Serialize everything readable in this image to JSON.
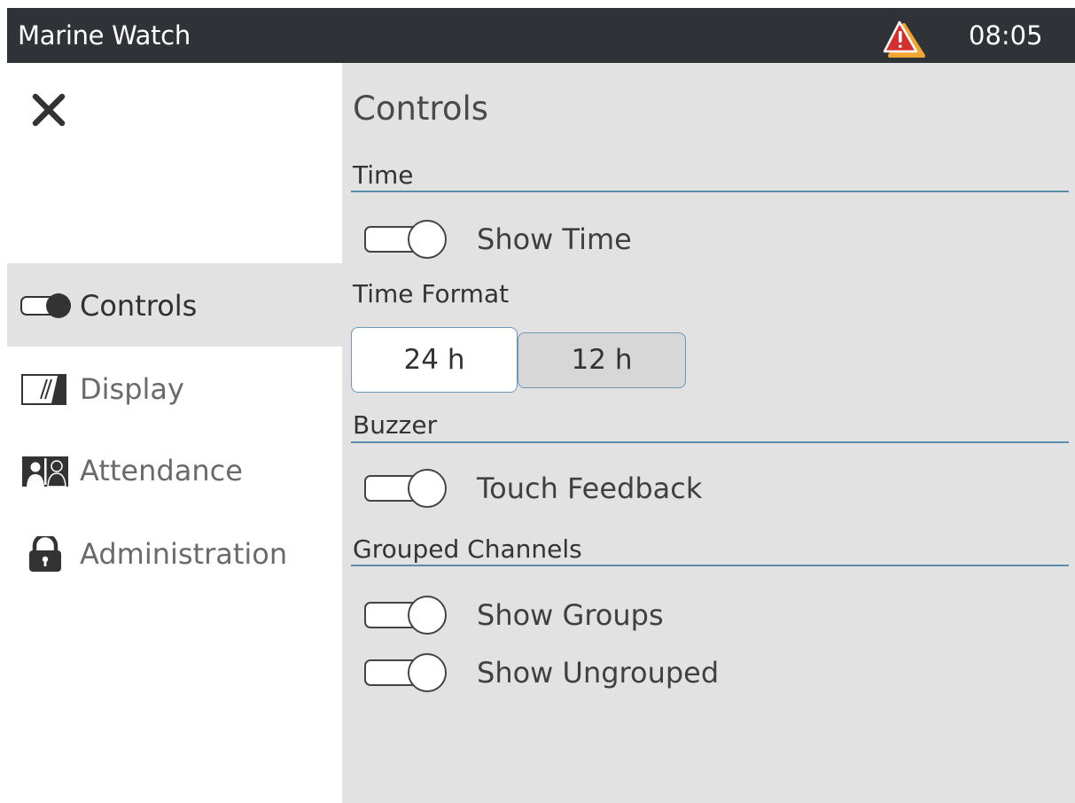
{
  "titlebar": {
    "app_title": "Marine Watch",
    "clock": "08:05",
    "warning_icon": "warning-triangle-icon"
  },
  "sidebar": {
    "close_icon": "close-icon",
    "items": [
      {
        "label": "Controls",
        "icon": "toggle-icon",
        "active": true
      },
      {
        "label": "Display",
        "icon": "display-icon",
        "active": false
      },
      {
        "label": "Attendance",
        "icon": "attendance-icon",
        "active": false
      },
      {
        "label": "Administration",
        "icon": "lock-icon",
        "active": false
      }
    ]
  },
  "main": {
    "page_title": "Controls",
    "sections": {
      "time": {
        "title": "Time",
        "show_time_label": "Show Time",
        "show_time_on": false
      },
      "time_format": {
        "title": "Time Format",
        "options": [
          "24 h",
          "12 h"
        ],
        "selected": "24 h"
      },
      "buzzer": {
        "title": "Buzzer",
        "touch_feedback_label": "Touch Feedback",
        "touch_feedback_on": false
      },
      "grouped_channels": {
        "title": "Grouped Channels",
        "show_groups_label": "Show Groups",
        "show_groups_on": false,
        "show_ungrouped_label": "Show Ungrouped",
        "show_ungrouped_on": false
      }
    }
  },
  "colors": {
    "titlebar_bg": "#2f3236",
    "content_bg": "#e2e2e2",
    "sidebar_bg": "#ffffff",
    "accent_line": "#5b8cac",
    "warning_red": "#d32f2f",
    "warning_amber": "#f2a531"
  }
}
